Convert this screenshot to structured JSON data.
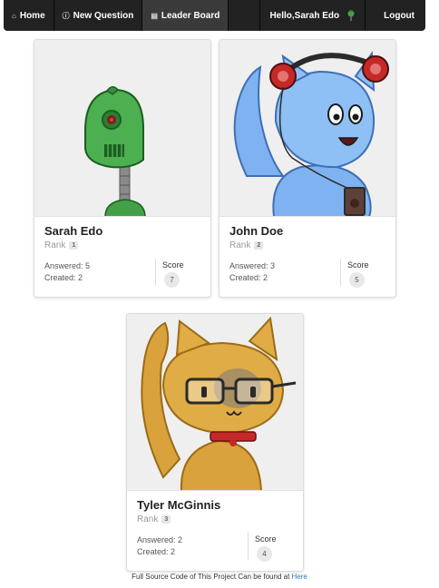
{
  "nav": {
    "home": "Home",
    "new_question": "New Question",
    "leaderboard": "Leader Board",
    "greeting": "Hello,Sarah Edo",
    "logout": "Logout"
  },
  "cards": [
    {
      "name": "Sarah Edo",
      "rank_label": "Rank",
      "rank": "1",
      "answered": "Answered: 5",
      "created": "Created: 2",
      "score_label": "Score",
      "score": "7",
      "avatar": "green-robot"
    },
    {
      "name": "John Doe",
      "rank_label": "Rank",
      "rank": "2",
      "answered": "Answered: 3",
      "created": "Created: 2",
      "score_label": "Score",
      "score": "5",
      "avatar": "blue-cat-headphones"
    },
    {
      "name": "Tyler McGinnis",
      "rank_label": "Rank",
      "rank": "3",
      "answered": "Answered: 2",
      "created": "Created: 2",
      "score_label": "Score",
      "score": "4",
      "avatar": "orange-cat-glasses"
    }
  ],
  "footer": {
    "text": "Full Source Code of This Project Can be found at",
    "link": "Here"
  },
  "colors": {
    "navbar": "#222222",
    "link": "#337ab7",
    "robot": "#4caf50",
    "blue_cat": "#7fb2f0",
    "orange_cat": "#d9a23c"
  }
}
